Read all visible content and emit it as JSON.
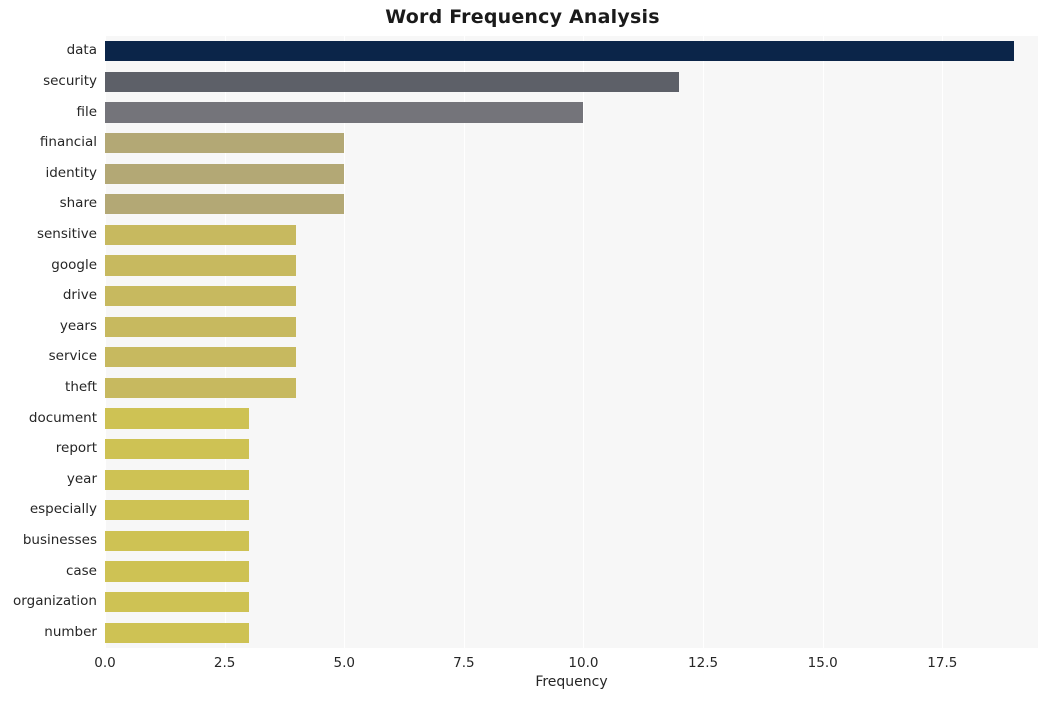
{
  "chart_data": {
    "type": "bar",
    "orientation": "horizontal",
    "title": "Word Frequency Analysis",
    "xlabel": "Frequency",
    "ylabel": "",
    "xlim": [
      0,
      19.5
    ],
    "xticks": [
      "0.0",
      "2.5",
      "5.0",
      "7.5",
      "10.0",
      "12.5",
      "15.0",
      "17.5"
    ],
    "xtick_values": [
      0,
      2.5,
      5,
      7.5,
      10,
      12.5,
      15,
      17.5
    ],
    "grid": "vertical",
    "legend": null,
    "categories": [
      "data",
      "security",
      "file",
      "financial",
      "identity",
      "share",
      "sensitive",
      "google",
      "drive",
      "years",
      "service",
      "theft",
      "document",
      "report",
      "year",
      "especially",
      "businesses",
      "case",
      "organization",
      "number"
    ],
    "values": [
      19,
      12,
      10,
      5,
      5,
      5,
      4,
      4,
      4,
      4,
      4,
      4,
      3,
      3,
      3,
      3,
      3,
      3,
      3,
      3
    ],
    "bar_colors": [
      "#0b2549",
      "#5d6068",
      "#74747a",
      "#b3a875",
      "#b3a875",
      "#b3a875",
      "#c7b95f",
      "#c7b95f",
      "#c7b95f",
      "#c7b95f",
      "#c7b95f",
      "#c7b95f",
      "#cec254",
      "#cec254",
      "#cec254",
      "#cec254",
      "#cec254",
      "#cec254",
      "#cec254",
      "#cec254"
    ],
    "plot_background": "#f7f7f7",
    "figure_background": "#ffffff",
    "gridline_color": "#ffffff",
    "text_color": "#262626"
  }
}
